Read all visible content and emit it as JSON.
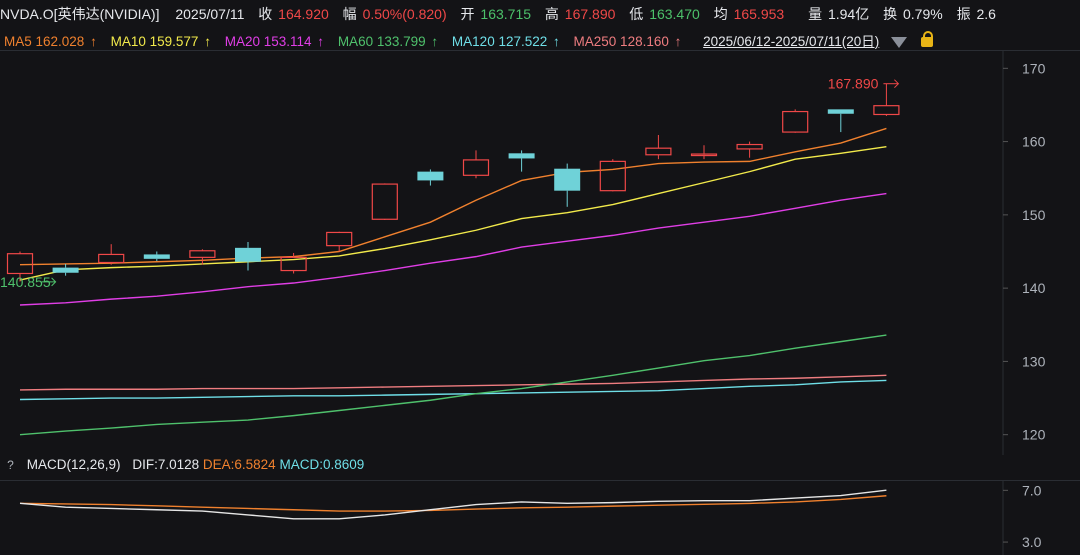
{
  "header": {
    "symbol": "NVDA.O[英伟达(NVIDIA)]",
    "date": "2025/07/11",
    "close_label": "收",
    "close": "164.920",
    "change_label": "幅",
    "change": "0.50%(0.820)",
    "open_label": "开",
    "open": "163.715",
    "high_label": "高",
    "high": "167.890",
    "low_label": "低",
    "low": "163.470",
    "avg_label": "均",
    "avg": "165.953",
    "vol_label": "量",
    "vol": "1.94亿",
    "turn_label": "换",
    "turn": "0.79%",
    "amp_label": "振",
    "amp": "2.6"
  },
  "ma_legend": [
    {
      "label": "MA5 162.028",
      "color": "#f0812e"
    },
    {
      "label": "MA10 159.577",
      "color": "#f2ea4b"
    },
    {
      "label": "MA20 153.114",
      "color": "#e03ee6"
    },
    {
      "label": "MA60 133.799",
      "color": "#4fc16c"
    },
    {
      "label": "MA120 127.522",
      "color": "#6fdfe8"
    },
    {
      "label": "MA250 128.160",
      "color": "#ef7d80"
    }
  ],
  "ma_arrow": "↑",
  "range_label": "2025/06/12-2025/07/11(20日)",
  "macd": {
    "params": "MACD(12,26,9)",
    "dif": "DIF:7.0128",
    "dea": "DEA:6.5824",
    "macd": "MACD:0.8609",
    "help": "?"
  },
  "colors": {
    "up": "#f04848",
    "down": "#6fd2d8",
    "dif": "#e6e6e6",
    "dea": "#f0812e"
  },
  "chart_data": {
    "type": "candlestick",
    "y_ticks": [
      170,
      160,
      150,
      140,
      130,
      120
    ],
    "ylim": [
      117.5,
      172.5
    ],
    "high_annotation": "167.890",
    "low_annotation": "140.855",
    "candles": [
      {
        "o": 142.0,
        "h": 145.0,
        "l": 140.9,
        "c": 144.7
      },
      {
        "o": 142.8,
        "h": 143.3,
        "l": 141.7,
        "c": 142.1
      },
      {
        "o": 143.5,
        "h": 146.0,
        "l": 143.2,
        "c": 144.6
      },
      {
        "o": 144.6,
        "h": 145.0,
        "l": 143.7,
        "c": 144.0
      },
      {
        "o": 144.2,
        "h": 145.3,
        "l": 143.2,
        "c": 145.1
      },
      {
        "o": 145.5,
        "h": 146.3,
        "l": 142.4,
        "c": 143.6
      },
      {
        "o": 142.4,
        "h": 144.8,
        "l": 142.0,
        "c": 144.2
      },
      {
        "o": 145.8,
        "h": 147.7,
        "l": 145.0,
        "c": 147.6
      },
      {
        "o": 149.4,
        "h": 154.3,
        "l": 149.3,
        "c": 154.2
      },
      {
        "o": 155.9,
        "h": 156.2,
        "l": 154.0,
        "c": 154.7
      },
      {
        "o": 155.4,
        "h": 158.8,
        "l": 155.0,
        "c": 157.5
      },
      {
        "o": 158.4,
        "h": 158.8,
        "l": 155.9,
        "c": 157.7
      },
      {
        "o": 156.3,
        "h": 157.0,
        "l": 151.1,
        "c": 153.3
      },
      {
        "o": 153.3,
        "h": 157.6,
        "l": 153.2,
        "c": 157.3
      },
      {
        "o": 158.2,
        "h": 160.9,
        "l": 157.6,
        "c": 159.1
      },
      {
        "o": 158.2,
        "h": 159.5,
        "l": 157.6,
        "c": 158.3
      },
      {
        "o": 159.0,
        "h": 160.0,
        "l": 157.8,
        "c": 159.6
      },
      {
        "o": 161.3,
        "h": 164.4,
        "l": 161.2,
        "c": 164.1
      },
      {
        "o": 164.4,
        "h": 164.4,
        "l": 161.3,
        "c": 163.8
      },
      {
        "o": 163.7,
        "h": 167.9,
        "l": 163.5,
        "c": 164.9
      }
    ],
    "ma_lines": [
      {
        "name": "MA5",
        "values": [
          143.2,
          143.3,
          143.4,
          143.6,
          143.8,
          144.1,
          144.3,
          145.0,
          147.0,
          149.0,
          152.0,
          154.7,
          155.8,
          156.2,
          157.0,
          157.2,
          157.3,
          158.6,
          159.8,
          161.8
        ]
      },
      {
        "name": "MA10",
        "values": [
          141.1,
          142.5,
          142.8,
          143.0,
          143.3,
          143.6,
          143.9,
          144.4,
          145.4,
          146.6,
          147.9,
          149.5,
          150.3,
          151.4,
          152.9,
          154.4,
          155.9,
          157.6,
          158.4,
          159.3
        ]
      },
      {
        "name": "MA20",
        "values": [
          137.7,
          138.0,
          138.5,
          138.9,
          139.5,
          140.2,
          140.7,
          141.5,
          142.4,
          143.4,
          144.3,
          145.6,
          146.4,
          147.2,
          148.2,
          149.0,
          149.8,
          150.9,
          152.0,
          152.9
        ]
      },
      {
        "name": "MA60",
        "values": [
          120.0,
          120.5,
          120.9,
          121.4,
          121.7,
          122.0,
          122.6,
          123.3,
          124.0,
          124.7,
          125.6,
          126.3,
          127.2,
          128.1,
          129.1,
          130.1,
          130.8,
          131.8,
          132.7,
          133.6
        ]
      },
      {
        "name": "MA120",
        "values": [
          124.8,
          124.9,
          125.0,
          125.0,
          125.1,
          125.2,
          125.3,
          125.3,
          125.4,
          125.5,
          125.6,
          125.7,
          125.8,
          125.9,
          126.0,
          126.3,
          126.6,
          126.8,
          127.2,
          127.4
        ]
      },
      {
        "name": "MA250",
        "values": [
          126.1,
          126.2,
          126.2,
          126.2,
          126.3,
          126.3,
          126.3,
          126.4,
          126.5,
          126.6,
          126.7,
          126.8,
          126.9,
          127.0,
          127.2,
          127.4,
          127.6,
          127.7,
          127.9,
          128.1
        ]
      }
    ],
    "macd_ylim": [
      2.0,
      7.8
    ],
    "macd_ticks": [
      7.0,
      3.0
    ],
    "dif": [
      6.0,
      5.7,
      5.6,
      5.5,
      5.4,
      5.1,
      4.8,
      4.8,
      5.1,
      5.5,
      5.9,
      6.1,
      6.0,
      6.05,
      6.15,
      6.2,
      6.2,
      6.4,
      6.6,
      7.0128
    ],
    "dea": [
      6.0,
      5.95,
      5.9,
      5.8,
      5.7,
      5.6,
      5.5,
      5.4,
      5.4,
      5.45,
      5.55,
      5.65,
      5.7,
      5.78,
      5.85,
      5.92,
      5.99,
      6.1,
      6.3,
      6.5824
    ]
  }
}
